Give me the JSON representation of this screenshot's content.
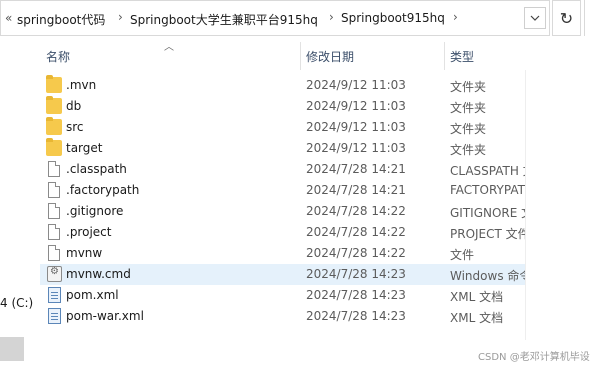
{
  "breadcrumb": {
    "chevron": "«",
    "items": [
      "springboot代码",
      "Springboot大学生兼职平台915hq",
      "Springboot915hq"
    ],
    "separator": "›"
  },
  "columns": {
    "name": "名称",
    "modified": "修改日期",
    "type": "类型"
  },
  "files": [
    {
      "name": ".mvn",
      "date": "2024/9/12 11:03",
      "type": "文件夹",
      "icon": "folder-icon"
    },
    {
      "name": "db",
      "date": "2024/9/12 11:03",
      "type": "文件夹",
      "icon": "folder-icon"
    },
    {
      "name": "src",
      "date": "2024/9/12 11:03",
      "type": "文件夹",
      "icon": "folder-icon"
    },
    {
      "name": "target",
      "date": "2024/9/12 11:03",
      "type": "文件夹",
      "icon": "folder-icon"
    },
    {
      "name": ".classpath",
      "date": "2024/7/28 14:21",
      "type": "CLASSPATH 文",
      "icon": "file-icon"
    },
    {
      "name": ".factorypath",
      "date": "2024/7/28 14:21",
      "type": "FACTORYPAT",
      "icon": "file-icon"
    },
    {
      "name": ".gitignore",
      "date": "2024/7/28 14:22",
      "type": "GITIGNORE 文",
      "icon": "file-icon"
    },
    {
      "name": ".project",
      "date": "2024/7/28 14:22",
      "type": "PROJECT 文件",
      "icon": "file-icon"
    },
    {
      "name": "mvnw",
      "date": "2024/7/28 14:22",
      "type": "文件",
      "icon": "file-icon"
    },
    {
      "name": "mvnw.cmd",
      "date": "2024/7/28 14:23",
      "type": "Windows 命令",
      "icon": "cmd-icon"
    },
    {
      "name": "pom.xml",
      "date": "2024/7/28 14:23",
      "type": "XML 文档",
      "icon": "xml-icon"
    },
    {
      "name": "pom-war.xml",
      "date": "2024/7/28 14:23",
      "type": "XML 文档",
      "icon": "xml-icon"
    }
  ],
  "nav": {
    "drive_fragment": "4 (C:)"
  },
  "watermark": "CSDN @老邓计算机毕设"
}
